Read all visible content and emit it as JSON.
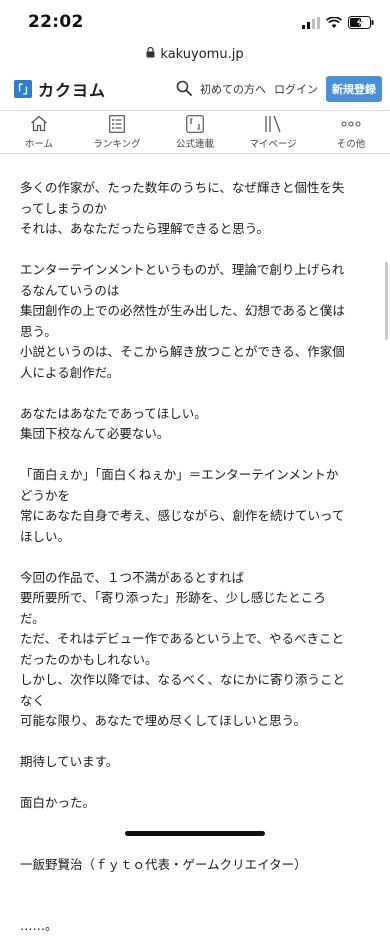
{
  "status": {
    "time": "22:02"
  },
  "browser": {
    "url": "kakuyomu.jp"
  },
  "header": {
    "logo_mark": "「」",
    "logo_text": "カクヨム",
    "beginner_link": "初めての方へ",
    "login_link": "ログイン",
    "register_button": "新規登録"
  },
  "nav": {
    "items": [
      {
        "label": "ホーム",
        "icon": "home-icon"
      },
      {
        "label": "ランキング",
        "icon": "ranking-icon"
      },
      {
        "label": "公式連載",
        "icon": "official-series-icon"
      },
      {
        "label": "マイページ",
        "icon": "mypage-icon"
      },
      {
        "label": "その他",
        "icon": "more-icon"
      }
    ]
  },
  "article": {
    "lines": [
      "多くの作家が、たった数年のうちに、なぜ輝きと個性を失",
      "ってしまうのか",
      "それは、あなただったら理解できると思う。",
      "",
      "エンターテインメントというものが、理論で創り上げられ",
      "るなんていうのは",
      "集団創作の上での必然性が生み出した、幻想であると僕は",
      "思う。",
      "小説というのは、そこから解き放つことができる、作家個",
      "人による創作だ。",
      "",
      "あなたはあなたであってほしい。",
      "集団下校なんて必要ない。",
      "",
      "「面白ぇか」「面白くねぇか」＝エンターテインメントか",
      "どうかを",
      "常にあなた自身で考え、感じながら、創作を続けていって",
      "ほしい。",
      "",
      "今回の作品で、１つ不満があるとすれば",
      "要所要所で、「寄り添った」形跡を、少し感じたところ",
      "だ。",
      "ただ、それはデビュー作であるという上で、やるべきこと",
      "だったのかもしれない。",
      "しかし、次作以降では、なるべく、なにかに寄り添うこと",
      "なく",
      "可能な限り、あなたで埋め尽くしてほしいと思う。",
      "",
      "期待しています。",
      "",
      "面白かった。",
      "",
      "",
      "一飯野賢治（ｆｙｔｏ代表・ゲームクリエイター）",
      "",
      "",
      "……。"
    ]
  }
}
